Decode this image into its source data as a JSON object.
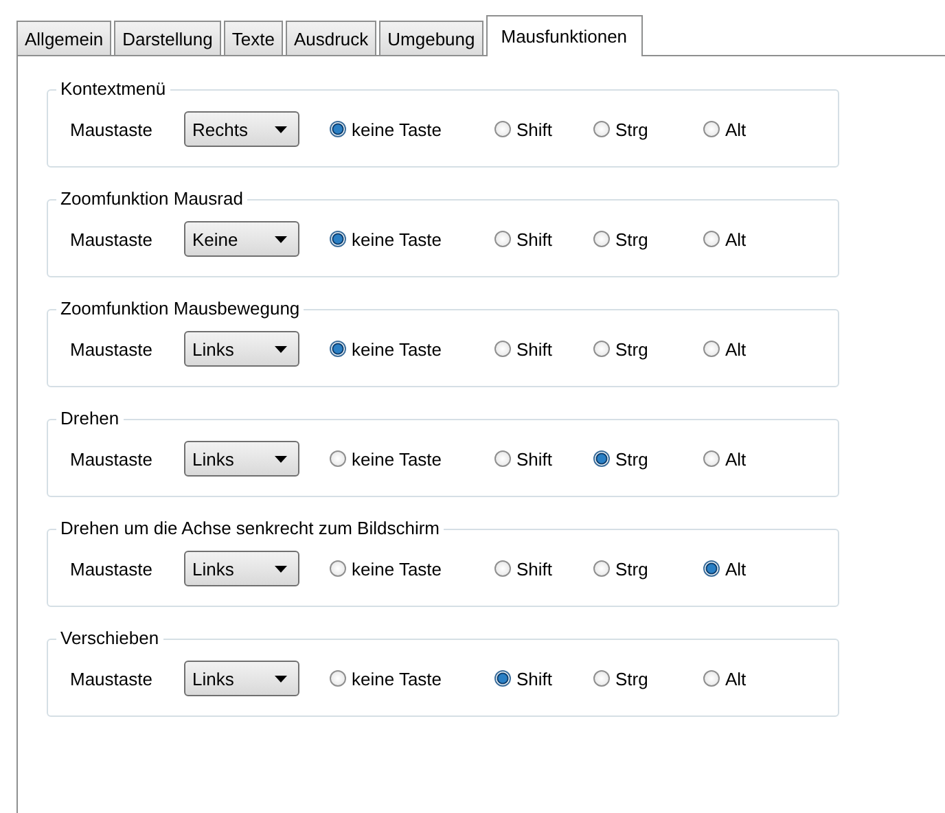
{
  "tabs": [
    {
      "label": "Allgemein",
      "selected": false
    },
    {
      "label": "Darstellung",
      "selected": false
    },
    {
      "label": "Texte",
      "selected": false
    },
    {
      "label": "Ausdruck",
      "selected": false
    },
    {
      "label": "Umgebung",
      "selected": false
    },
    {
      "label": "Mausfunktionen",
      "selected": true
    }
  ],
  "groups": [
    {
      "title": "Kontextmenü",
      "label": "Maustaste",
      "dropdown": "Rechts",
      "options": [
        {
          "label": "keine Taste",
          "selected": true
        },
        {
          "label": "Shift",
          "selected": false
        },
        {
          "label": "Strg",
          "selected": false
        },
        {
          "label": "Alt",
          "selected": false
        }
      ]
    },
    {
      "title": "Zoomfunktion Mausrad",
      "label": "Maustaste",
      "dropdown": "Keine",
      "options": [
        {
          "label": "keine Taste",
          "selected": true
        },
        {
          "label": "Shift",
          "selected": false
        },
        {
          "label": "Strg",
          "selected": false
        },
        {
          "label": "Alt",
          "selected": false
        }
      ]
    },
    {
      "title": "Zoomfunktion Mausbewegung",
      "label": "Maustaste",
      "dropdown": "Links",
      "options": [
        {
          "label": "keine Taste",
          "selected": true
        },
        {
          "label": "Shift",
          "selected": false
        },
        {
          "label": "Strg",
          "selected": false
        },
        {
          "label": "Alt",
          "selected": false
        }
      ]
    },
    {
      "title": "Drehen",
      "label": "Maustaste",
      "dropdown": "Links",
      "options": [
        {
          "label": "keine Taste",
          "selected": false
        },
        {
          "label": "Shift",
          "selected": false
        },
        {
          "label": "Strg",
          "selected": true
        },
        {
          "label": "Alt",
          "selected": false
        }
      ]
    },
    {
      "title": "Drehen um die Achse senkrecht zum Bildschirm",
      "label": "Maustaste",
      "dropdown": "Links",
      "options": [
        {
          "label": "keine Taste",
          "selected": false
        },
        {
          "label": "Shift",
          "selected": false
        },
        {
          "label": "Strg",
          "selected": false
        },
        {
          "label": "Alt",
          "selected": true
        }
      ]
    },
    {
      "title": "Verschieben",
      "label": "Maustaste",
      "dropdown": "Links",
      "options": [
        {
          "label": "keine Taste",
          "selected": false
        },
        {
          "label": "Shift",
          "selected": true
        },
        {
          "label": "Strg",
          "selected": false
        },
        {
          "label": "Alt",
          "selected": false
        }
      ]
    }
  ]
}
